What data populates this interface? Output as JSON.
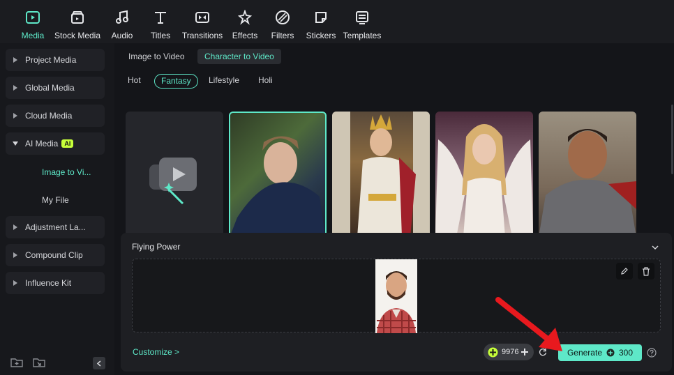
{
  "toolbar": {
    "items": [
      {
        "label": "Media",
        "icon": "media-icon",
        "active": true
      },
      {
        "label": "Stock Media",
        "icon": "stock-media-icon"
      },
      {
        "label": "Audio",
        "icon": "music-note-icon"
      },
      {
        "label": "Titles",
        "icon": "title-t-icon"
      },
      {
        "label": "Transitions",
        "icon": "transitions-icon"
      },
      {
        "label": "Effects",
        "icon": "effects-icon"
      },
      {
        "label": "Filters",
        "icon": "filters-icon"
      },
      {
        "label": "Stickers",
        "icon": "stickers-icon"
      },
      {
        "label": "Templates",
        "icon": "templates-icon"
      }
    ]
  },
  "sidebar": {
    "items": [
      {
        "label": "Project Media"
      },
      {
        "label": "Global Media"
      },
      {
        "label": "Cloud Media"
      },
      {
        "label": "AI Media",
        "badge": "AI",
        "expanded": true
      },
      {
        "label": "Adjustment La..."
      },
      {
        "label": "Compound Clip"
      },
      {
        "label": "Influence Kit"
      }
    ],
    "sub_items": [
      {
        "label": "Image to Vi...",
        "active": true
      },
      {
        "label": "My File"
      }
    ]
  },
  "tabs": [
    {
      "label": "Image to Video"
    },
    {
      "label": "Character to Video",
      "active": true
    }
  ],
  "categories": [
    {
      "label": "Hot"
    },
    {
      "label": "Fantasy",
      "active": true
    },
    {
      "label": "Lifestyle"
    },
    {
      "label": "Holi"
    }
  ],
  "panel": {
    "title": "Flying Power",
    "customize": "Customize >",
    "credits": "9976",
    "generate": "Generate",
    "cost": "300"
  },
  "colors": {
    "accent": "#5ee8c8",
    "background": "#141519",
    "panel": "#1e1f23"
  }
}
